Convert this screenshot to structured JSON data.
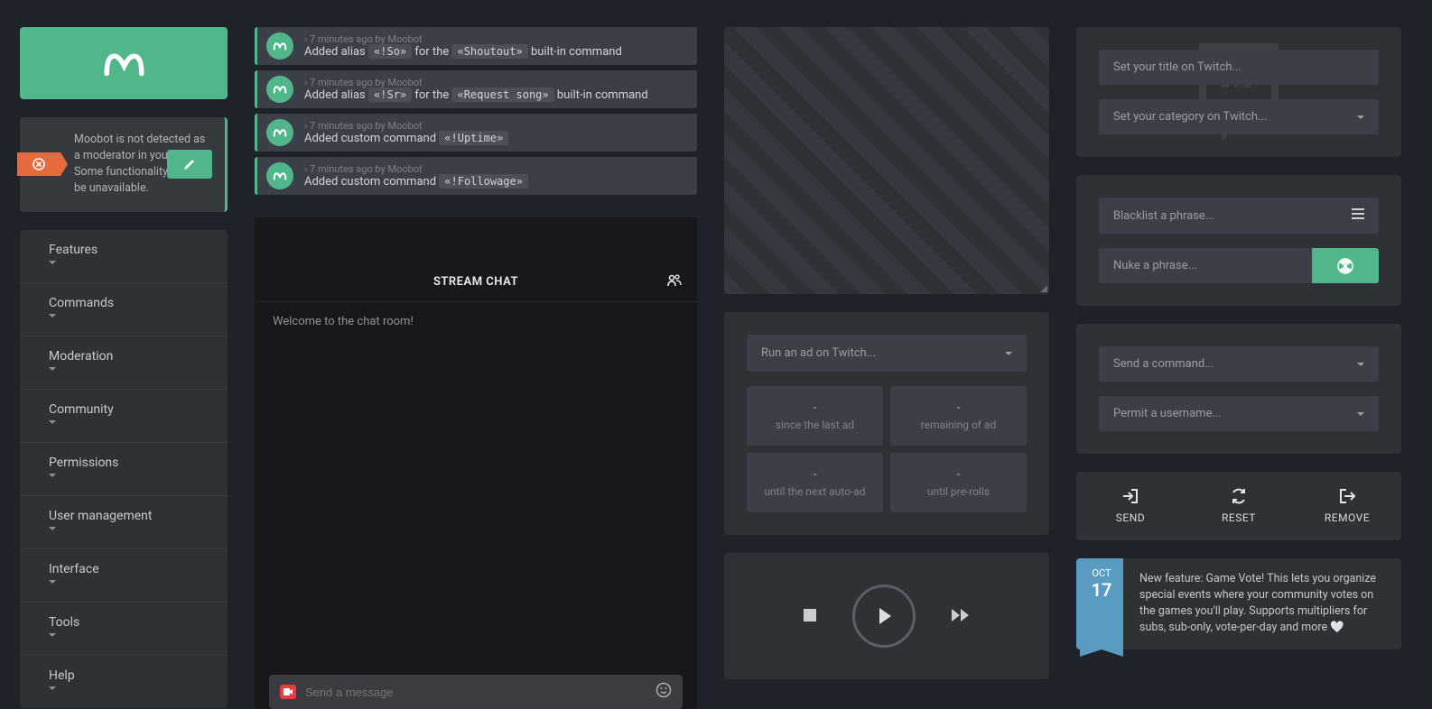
{
  "warning": {
    "text": "Moobot is not detected as a moderator in your chat. Some functionality may be unavailable."
  },
  "nav": [
    {
      "label": "Features"
    },
    {
      "label": "Commands"
    },
    {
      "label": "Moderation"
    },
    {
      "label": "Community"
    },
    {
      "label": "Permissions"
    },
    {
      "label": "User management"
    },
    {
      "label": "Interface"
    },
    {
      "label": "Tools"
    },
    {
      "label": "Help"
    }
  ],
  "logs": [
    {
      "meta": "› 7 minutes ago by Moobot",
      "prefix": "Added alias",
      "cmd": "«!So»",
      "mid": "for the",
      "cmd2": "«Shoutout»",
      "suffix": "built-in command"
    },
    {
      "meta": "› 7 minutes ago by Moobot",
      "prefix": "Added alias",
      "cmd": "«!Sr»",
      "mid": "for the",
      "cmd2": "«Request song»",
      "suffix": "built-in command"
    },
    {
      "meta": "› 7 minutes ago by Moobot",
      "prefix": "Added custom command",
      "cmd": "«!Uptime»",
      "mid": "",
      "cmd2": "",
      "suffix": ""
    },
    {
      "meta": "› 7 minutes ago by Moobot",
      "prefix": "Added custom command",
      "cmd": "«!Followage»",
      "mid": "",
      "cmd2": "",
      "suffix": ""
    }
  ],
  "chat": {
    "header": "STREAM CHAT",
    "welcome": "Welcome to the chat room!",
    "input_placeholder": "Send a message"
  },
  "ads": {
    "run_placeholder": "Run an ad on Twitch...",
    "stats": [
      {
        "val": "-",
        "lbl": "since the last ad"
      },
      {
        "val": "-",
        "lbl": "remaining of ad"
      },
      {
        "val": "-",
        "lbl": "until the next auto-ad"
      },
      {
        "val": "-",
        "lbl": "until pre-rolls"
      }
    ]
  },
  "title_panel": {
    "title_placeholder": "Set your title on Twitch...",
    "category_placeholder": "Set your category on Twitch..."
  },
  "blacklist": {
    "blacklist_placeholder": "Blacklist a phrase...",
    "nuke_placeholder": "Nuke a phrase..."
  },
  "commands_panel": {
    "send_placeholder": "Send a command...",
    "permit_placeholder": "Permit a username..."
  },
  "actions": {
    "send": "SEND",
    "reset": "RESET",
    "remove": "REMOVE"
  },
  "news": {
    "month": "OCT",
    "day": "17",
    "text": "New feature: Game Vote! This lets you organize special events where your community votes on the games you'll play. Supports multipliers for subs, sub-only, vote-per-day and more 🤍"
  }
}
